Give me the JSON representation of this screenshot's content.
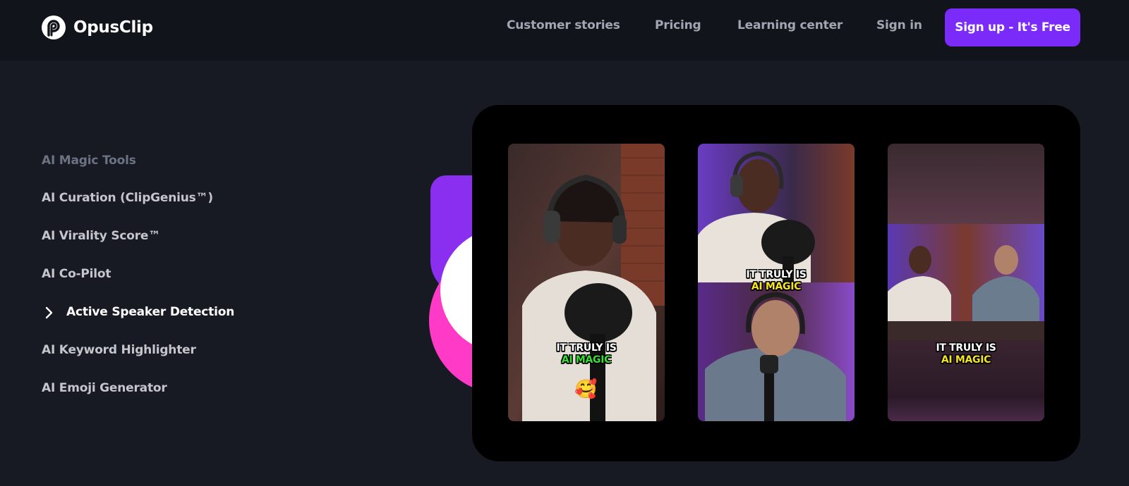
{
  "header": {
    "brand": "OpusClip",
    "nav": {
      "customer_stories": "Customer stories",
      "pricing": "Pricing",
      "learning_center": "Learning center",
      "sign_in": "Sign in"
    },
    "signup_label": "Sign up - It's Free"
  },
  "menu": {
    "heading": "AI Magic Tools",
    "items": [
      {
        "label": "AI Curation (ClipGenius™)",
        "active": false
      },
      {
        "label": "AI Virality Score™",
        "active": false
      },
      {
        "label": "AI Co-Pilot",
        "active": false
      },
      {
        "label": "Active Speaker Detection",
        "active": true
      },
      {
        "label": "AI Keyword Highlighter",
        "active": false
      },
      {
        "label": "AI Emoji Generator",
        "active": false
      }
    ]
  },
  "preview": {
    "clips": [
      {
        "caption_line1": "IT TRULY IS",
        "caption_line2": "AI MAGIC",
        "highlight_color": "#35e034",
        "emoji": "🥰"
      },
      {
        "caption_line1": "IT TRULY IS",
        "caption_line2": "AI MAGIC",
        "highlight_color": "#f5e51a"
      },
      {
        "caption_line1": "IT TRULY IS",
        "caption_line2": "AI MAGIC",
        "highlight_color": "#f5e51a"
      }
    ]
  },
  "colors": {
    "background": "#181a23",
    "header_bg": "#12141b",
    "accent_purple": "#7b2bf9",
    "accent_pink": "#ff3ac6",
    "accent_violet": "#8a2ef0"
  },
  "icons": [
    "opusclip-logo-icon",
    "chevron-right-icon",
    "emoji-icon"
  ]
}
